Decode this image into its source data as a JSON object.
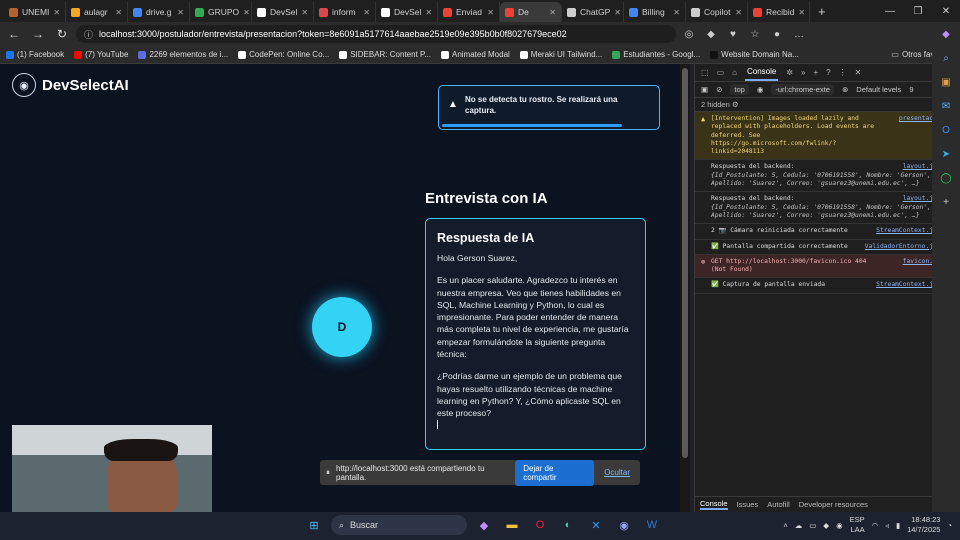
{
  "browser": {
    "tabs": [
      {
        "label": "UNEMI",
        "color": "#b5632b"
      },
      {
        "label": "aulagr",
        "color": "#f5a623"
      },
      {
        "label": "drive.g",
        "color": "#4285f4"
      },
      {
        "label": "GRUPO",
        "color": "#34a853"
      },
      {
        "label": "DevSel",
        "color": "#ffffff"
      },
      {
        "label": "inform",
        "color": "#d84a4a"
      },
      {
        "label": "DevSel",
        "color": "#ffffff"
      },
      {
        "label": "Enviad",
        "color": "#ea4335"
      },
      {
        "label": "De",
        "color": "#ea4335",
        "active": true
      },
      {
        "label": "ChatGP",
        "color": "#cccccc"
      },
      {
        "label": "Billing",
        "color": "#4285f4"
      },
      {
        "label": "Copilot",
        "color": "#cccccc"
      },
      {
        "label": "Recibid",
        "color": "#ea4335"
      }
    ],
    "new_tab": "+",
    "address": "localhost:3000/postulador/entrevista/presentacion?token=8e6091a5177614aaebae2519e09e395b0b0f8027679ece02",
    "bookmarks": [
      {
        "label": "(1) Facebook",
        "color": "#1877f2"
      },
      {
        "label": "(7) YouTube",
        "color": "#ff0000"
      },
      {
        "label": "2269 elementos de i...",
        "color": "#5b6ee1"
      },
      {
        "label": "CodePen: Online Co...",
        "color": "#ffffff"
      },
      {
        "label": "SIDEBAR: Content P...",
        "color": "#ffffff"
      },
      {
        "label": "Animated Modal",
        "color": "#ffffff"
      },
      {
        "label": "Meraki UI Tailwind...",
        "color": "#ffffff"
      },
      {
        "label": "Estudiantes - Googl...",
        "color": "#34a853"
      },
      {
        "label": "Website Domain Na...",
        "color": "#111111"
      }
    ],
    "other_favorites": "Otros favoritos"
  },
  "app": {
    "brand": "DevSelectAI",
    "alert": "No se detecta tu rostro. Se realizará una captura.",
    "title": "Entrevista con IA",
    "avatar_letter": "D",
    "card_title": "Respuesta de IA",
    "greeting": "Hola Gerson Suarez,",
    "paragraph1": "Es un placer saludarte. Agradezco tu interés en nuestra empresa. Veo que tienes habilidades en SQL, Machine Learning y Python, lo cual es impresionante. Para poder entender de manera más completa tu nivel de experiencia, me gustaría empezar formulándote la siguiente pregunta técnica:",
    "paragraph2": "¿Podrías darme un ejemplo de un problema que hayas resuelto utilizando técnicas de machine learning en Python? Y, ¿Cómo aplicaste SQL en este proceso?",
    "share_text": "http://localhost:3000 está compartiendo tu pantalla.",
    "stop_label": "Dejar de compartir",
    "hide_label": "Ocultar",
    "accent": "#32d3f5"
  },
  "devtools": {
    "active_tab": "Console",
    "filter_top": "top",
    "filter_text": "-url:chrome-exte",
    "levels": "Default levels",
    "issues_count": "9",
    "hidden": "2 hidden",
    "messages": [
      {
        "type": "warn",
        "text": "[Intervention] Images loaded lazily and replaced with placeholders. Load events are deferred. See https://go.microsoft.com/fwlink/?linkid=2048113",
        "src": "presentacion:1"
      },
      {
        "type": "log",
        "text": "Respuesta del backend:",
        "detail": "{Id_Postulante: 5, Cedula: '0706191558', Nombre: 'Gerson', Apellido: 'Suarez', Correo: 'gsuarez3@unemi.edu.ec', …}",
        "src": "layout.jsx:25"
      },
      {
        "type": "log",
        "text": "Respuesta del backend:",
        "detail": "{Id_Postulante: 5, Cedula: '0706191558', Nombre: 'Gerson', Apellido: 'Suarez', Correo: 'gsuarez3@unemi.edu.ec', …}",
        "src": "layout.jsx:25"
      },
      {
        "type": "log",
        "text": "2 📷 Cámara reiniciada correctamente",
        "src": "StreamContext.jsx:18"
      },
      {
        "type": "log",
        "text": "✅ Pantalla compartida correctamente",
        "src": "ValidadorEntorno.jsx:43"
      },
      {
        "type": "err",
        "text": "GET http://localhost:3000/favicon.ico 404 (Not Found)",
        "src": "favicon.ico:1"
      },
      {
        "type": "log",
        "text": "✅ Captura de pantalla enviada",
        "src": "StreamContext.jsx:62"
      }
    ],
    "drawer_tabs": [
      "Console",
      "Issues",
      "Autofill",
      "Developer resources"
    ]
  },
  "taskbar": {
    "search": "Buscar",
    "lang": "ESP",
    "lang2": "LAA",
    "time": "18:48:23",
    "date": "14/7/2025"
  }
}
